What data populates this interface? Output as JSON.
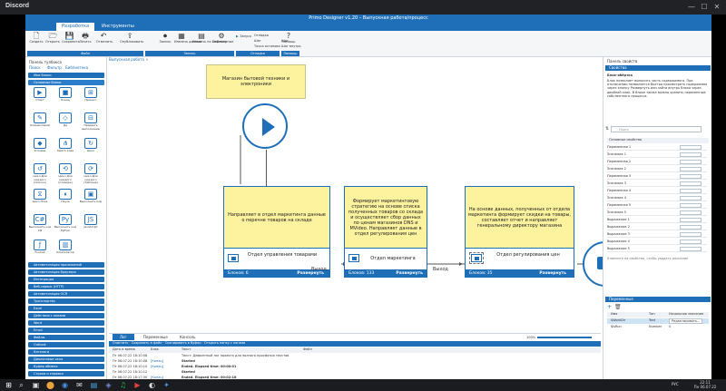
{
  "discord": {
    "title": "Discord",
    "min": "—",
    "max": "☐",
    "close": "✕"
  },
  "window": {
    "title": "Primo Designer v1.20 – Выпускная работа/процесс"
  },
  "ribbon": {
    "tabs": [
      {
        "label": "Разработка"
      },
      {
        "label": "Инструменты"
      }
    ],
    "buttons": [
      {
        "icon": "new-icon",
        "glyph": "🗋",
        "label": "Создать"
      },
      {
        "icon": "open-icon",
        "glyph": "🗁",
        "label": "Открыть"
      },
      {
        "icon": "save-icon",
        "glyph": "💾",
        "label": "Сохранить"
      },
      {
        "icon": "print-icon",
        "glyph": "🖶",
        "label": "Печать"
      },
      {
        "icon": "undo-icon",
        "glyph": "↶",
        "label": "Отменить"
      },
      {
        "icon": "publish-icon",
        "glyph": "⇪",
        "label": "Опубликовать"
      },
      {
        "icon": "record-icon",
        "glyph": "⏺",
        "label": "Запись"
      },
      {
        "icon": "variables-icon",
        "glyph": "▦",
        "label": "Извлечь данные"
      },
      {
        "icon": "arguments-icon",
        "glyph": "▤",
        "label": "Извлечь по шаблону"
      },
      {
        "icon": "config-icon",
        "glyph": "⚙",
        "label": "Переменные"
      },
      {
        "icon": "run-icon",
        "glyph": "▶",
        "label": "Запуск"
      },
      {
        "icon": "help-icon",
        "glyph": "?",
        "label": "Помощь"
      }
    ],
    "debug_items": [
      "Отладка",
      "Шаг",
      "Точка останова"
    ],
    "debug_items2": [
      "Шаг",
      "Шаг внутрь"
    ],
    "groups": [
      "Файл",
      "Запись",
      "Отладка",
      "Помощь"
    ]
  },
  "left": {
    "title": "Панель тулбокса",
    "search_hint": "Поиск",
    "filter": "Фильтр",
    "library": "Библиотека",
    "categories_top": [
      "Мои блоки",
      "Основные блоки"
    ],
    "tools": [
      {
        "glyph": "▶",
        "label": "Старт"
      },
      {
        "glyph": "■",
        "label": "Конец"
      },
      {
        "glyph": "⊞",
        "label": "Процесс"
      },
      {
        "glyph": "✎",
        "label": "Комментарий"
      },
      {
        "glyph": "◇",
        "label": "Да"
      },
      {
        "glyph": "⊟",
        "label": "Прервать выполнение"
      },
      {
        "glyph": "◆",
        "label": "Условие"
      },
      {
        "glyph": "⋔",
        "label": "Switch Case"
      },
      {
        "glyph": "↻",
        "label": "Цикл"
      },
      {
        "glyph": "↺",
        "label": "Цикл Для каждого (Список)"
      },
      {
        "glyph": "⟲",
        "label": "Цикл Для каждого (Словарь)"
      },
      {
        "glyph": "⟳",
        "label": "Цикл Для каждого (Таблица)"
      },
      {
        "glyph": "⧖",
        "label": "Цикл Пока"
      },
      {
        "glyph": "⏸",
        "label": "Пауза"
      },
      {
        "glyph": "▣",
        "label": "Выполнить код"
      },
      {
        "glyph": "C#",
        "label": "Выполнить код C#"
      },
      {
        "glyph": "Py",
        "label": "Выполнить код Python"
      },
      {
        "glyph": "JS",
        "label": "JavaScript"
      },
      {
        "glyph": "ƒ",
        "label": "FunCall"
      },
      {
        "glyph": "▥",
        "label": "Компилятор"
      }
    ],
    "categories_bottom": [
      "Автоматизация приложений",
      "Автоматизация браузера",
      "Интеграция",
      "Веб-сервис (HTTP)",
      "Автоматизация OCR",
      "Транспортёр",
      "Excel",
      "Действия с окнами",
      "Word",
      "Email",
      "Файлы",
      "Outlook",
      "Каталоги",
      "Диалоговые окна",
      "Буфер обмена",
      "Строки и справки"
    ]
  },
  "document_tab": "Выпускная работа",
  "canvas": {
    "top_note": "Магазин бытовой техники и электроники",
    "processes": [
      {
        "note": "Направляет в отдел маркетинга данные о перечне товаров на складе",
        "name": "Отдел управления товарами",
        "blocks": "Блоков: 6",
        "expand": "Развернуть"
      },
      {
        "note": "Формирует маркетинговую стратегию на основе списка полученных товаров со склада и осуществляет сбор данных по ценам магазинов DNS и MVideo. Направляет данные в отдел регулирования цен",
        "name": "Отдел маркетинга",
        "blocks": "Блоков: 133",
        "expand": "Развернуть"
      },
      {
        "note": "На основе данных, полученных от отдела маркетинга формирует скидки на товары, составляет отчет и направляет генеральному директору магазина",
        "name": "Отдел регулирования цен",
        "blocks": "Блоков: 35",
        "expand": "Развернуть"
      }
    ],
    "edge_label": "Выход"
  },
  "bottom": {
    "tabs": [
      "Лог",
      "Переменные",
      "Консоль"
    ],
    "toolbar": "Очистить · Сохранить в файл · Скопировать в буфер · Открыть папку с логами",
    "zoom": "100%",
    "columns": [
      "Дата и время",
      "Блок",
      "Текст",
      "Файл"
    ],
    "rows": [
      {
        "time": "Пт 06.07.22 18:10:08",
        "block": "",
        "text": "Текст: Дефолтный лог проекта для полного просмотра текстов"
      },
      {
        "time": "Пт 06.07.22 18:10:08",
        "block": "[Конец]",
        "text": "Started"
      },
      {
        "time": "Пт 06.07.22 18:10:10",
        "block": "[Конец]",
        "text": "Ended. Elapsed time: 00:00:01"
      },
      {
        "time": "Пт 06.07.22 18:10:12",
        "block": "",
        "text": "Started"
      },
      {
        "time": "Пт 06.07.22 18:17:30",
        "block": "[Конец]",
        "text": "Ended. Elapsed time: 00:02:18"
      }
    ]
  },
  "right": {
    "header1": "Свойства",
    "panel_title": "Панель свойств",
    "block_type": "Блок-обёртка",
    "description": "Блок позволяет выносить часть содержимого. При отключении позволяется быстро просмотреть содержимое через кнопку Развернуть или зайти внутрь блока через двойной клик. В блоке также можно хранить переменные собственного процесса.",
    "search_placeholder": "Поиск",
    "section": "Основные свойства",
    "props": [
      "Переменная 1",
      "Значение 1",
      "Переменная 2",
      "Значение 2",
      "Переменная 3",
      "Значение 3",
      "Переменная 4",
      "Значение 4",
      "Переменная 5",
      "Значение 5",
      "Выражение 1",
      "Выражение 2",
      "Выражение 3",
      "Выражение 4",
      "Выражение 5"
    ],
    "hint": "Кликните на свойство, чтобы увидеть описание",
    "header2": "Переменные",
    "var_columns": [
      "Имя",
      "Тип",
      "Начальное значение"
    ],
    "vars": [
      {
        "name": "$WorkDir",
        "type": "Text",
        "value": "Редактировать..."
      },
      {
        "name": "$isRun",
        "type": "Number",
        "value": "0"
      }
    ]
  },
  "taskbar": {
    "start": "⊞",
    "search": "⌕",
    "apps": [
      "▣",
      "⬤",
      "◉",
      "✉",
      "▤",
      "◈",
      "♫",
      "▶",
      "◐",
      "✦"
    ],
    "lang": "РУС",
    "time": "22:11",
    "date": "Пн 06.07.22"
  }
}
